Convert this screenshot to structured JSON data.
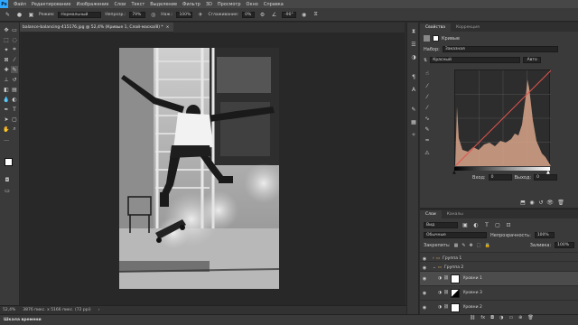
{
  "menu": {
    "logo": "Ps",
    "items": [
      "Файл",
      "Редактирование",
      "Изображение",
      "Слои",
      "Текст",
      "Выделение",
      "Фильтр",
      "3D",
      "Просмотр",
      "Окно",
      "Справка"
    ]
  },
  "options": {
    "mode_label": "Режим:",
    "mode_value": "Нормальный",
    "opacity_label": "Непрозр.:",
    "opacity_value": "79%",
    "press_label": "Наж.:",
    "press_value": "100%",
    "smoothing_label": "Сглаживание:",
    "smoothing_value": "0%",
    "angle_value": "-90°"
  },
  "document": {
    "tab_title": "balance-balancing-415176.jpg @ 52,4% (Кривые 1, Слой-маска/8) *",
    "close_glyph": "×"
  },
  "status": {
    "zoom": "52,4%",
    "doc_info": "3876 пикс. x 5166 пикс. (72 ppi)",
    "arrow": "›"
  },
  "timeline": {
    "title": "Шкала времени"
  },
  "properties": {
    "tab_properties": "Свойства",
    "tab_adjustments": "Коррекция",
    "adjustment_name": "Кривые",
    "preset_label": "Набор:",
    "preset_value": "Заказная",
    "channel_value": "Красный",
    "auto_button": "Авто",
    "input_label": "Вход:",
    "input_value": "0",
    "output_label": "Выход:",
    "output_value": "0"
  },
  "layers": {
    "tab_layers": "Слои",
    "tab_channels": "Каналы",
    "filter_kind": "Вид",
    "blend_mode": "Обычные",
    "opacity_label": "Непрозрачность:",
    "opacity_value": "100%",
    "lock_label": "Закрепить:",
    "fill_label": "Заливка:",
    "fill_value": "100%",
    "rows": [
      {
        "name": "Группа 1",
        "type": "group",
        "selected": false
      },
      {
        "name": "Группа 2",
        "type": "group",
        "selected": false
      },
      {
        "name": "Уровни 1",
        "type": "adjustment",
        "selected": true
      },
      {
        "name": "Уровни 3",
        "type": "adjustment",
        "selected": false
      },
      {
        "name": "Уровни 2",
        "type": "adjustment",
        "selected": false
      }
    ]
  },
  "colors": {
    "accent": "#31a8ff",
    "curve_red": "#e2544e",
    "histogram_fill": "#d9a58b"
  }
}
